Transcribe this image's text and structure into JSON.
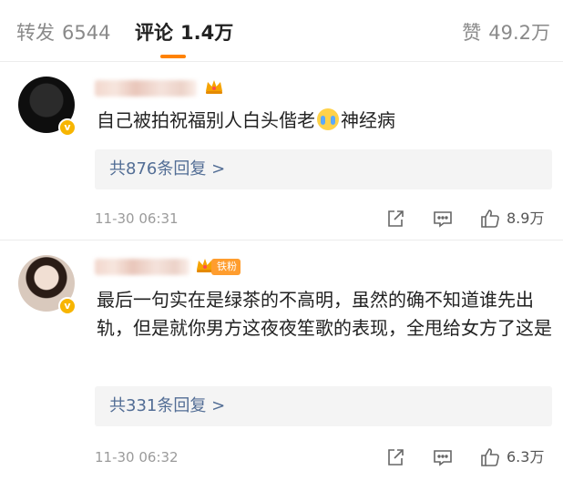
{
  "tabs": {
    "repost": {
      "label": "转发",
      "count": "6544"
    },
    "comments": {
      "label": "评论",
      "count": "1.4万"
    },
    "likes": {
      "label": "赞",
      "count": "49.2万"
    },
    "active": "comments",
    "accent_color": "#ff8200"
  },
  "comments": [
    {
      "username": "",
      "badges": [
        "crown-icon"
      ],
      "text_before_emoji": "自己被拍祝福别人白头偕老",
      "emoji": "cry-emoji",
      "text_after_emoji": "神经病",
      "replies_label": "共876条回复 >",
      "time": "11-30 06:31",
      "likes": "8.9万"
    },
    {
      "username": "",
      "badges": [
        "crown-icon",
        "fan-badge"
      ],
      "fan_badge_label": "铁粉",
      "text": "最后一句实在是绿茶的不高明，虽然的确不知道谁先出轨，但是就你男方这夜夜笙歌的表现，全甩给女方了这是",
      "replies_label": "共331条回复 >",
      "time": "11-30 06:32",
      "likes": "6.3万"
    }
  ],
  "colors": {
    "link": "#526d95",
    "verified": "#f7b500",
    "fan_badge": "#ff9d2e"
  }
}
